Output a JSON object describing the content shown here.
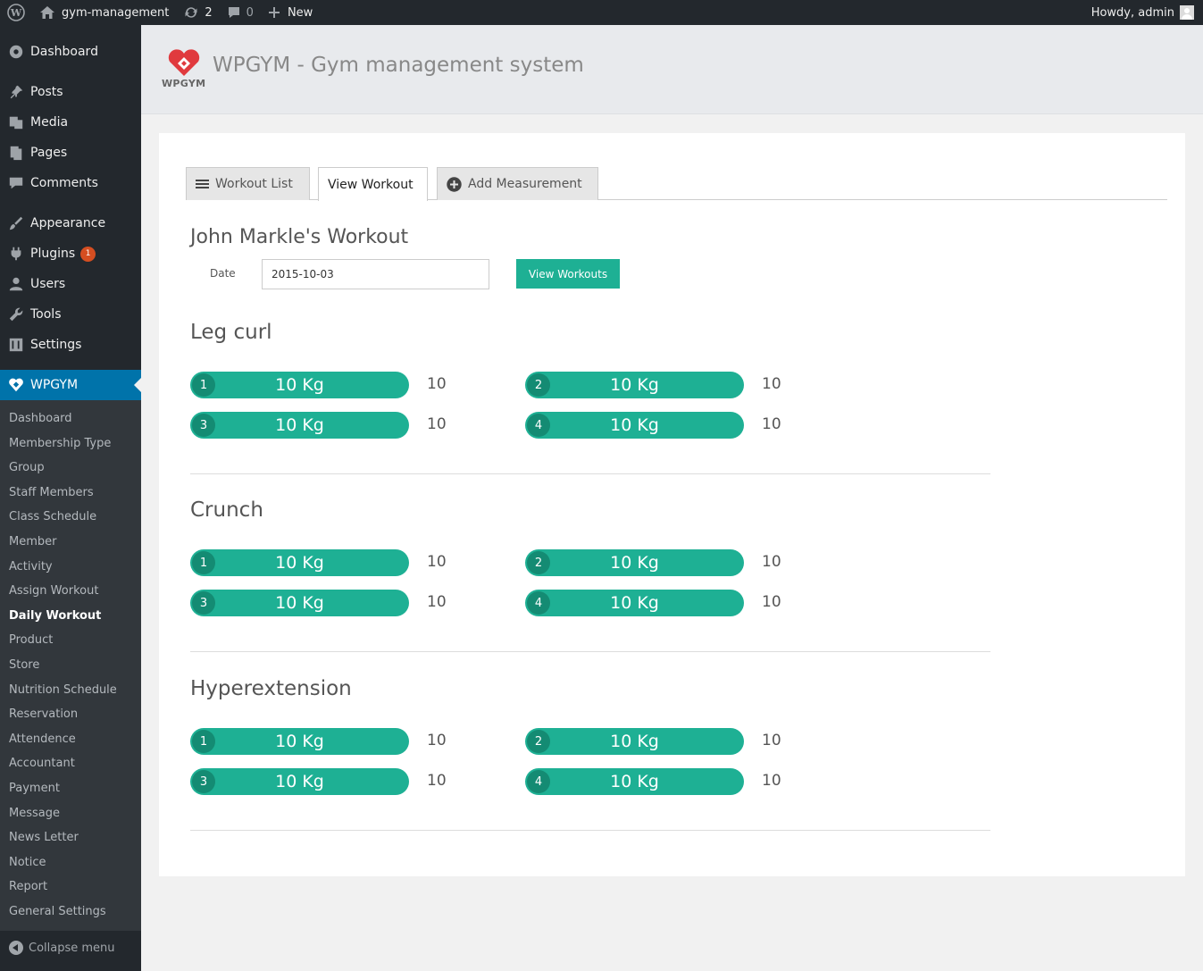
{
  "adminbar": {
    "site_name": "gym-management",
    "updates_count": "2",
    "comments_count": "0",
    "new_label": "New",
    "howdy": "Howdy, admin"
  },
  "sidebar": {
    "top_items": [
      {
        "label": "Dashboard",
        "icon": "dashboard-icon"
      },
      {
        "label": "Posts",
        "icon": "pin-icon"
      },
      {
        "label": "Media",
        "icon": "media-icon"
      },
      {
        "label": "Pages",
        "icon": "pages-icon"
      },
      {
        "label": "Comments",
        "icon": "comment-icon"
      },
      {
        "label": "Appearance",
        "icon": "brush-icon"
      },
      {
        "label": "Plugins",
        "icon": "plug-icon",
        "badge": "1"
      },
      {
        "label": "Users",
        "icon": "user-icon"
      },
      {
        "label": "Tools",
        "icon": "wrench-icon"
      },
      {
        "label": "Settings",
        "icon": "settings-icon"
      }
    ],
    "active_item": {
      "label": "WPGYM",
      "icon": "wpgym-icon"
    },
    "sub_items": [
      "Dashboard",
      "Membership Type",
      "Group",
      "Staff Members",
      "Class Schedule",
      "Member",
      "Activity",
      "Assign Workout",
      "Daily Workout",
      "Product",
      "Store",
      "Nutrition Schedule",
      "Reservation",
      "Attendence",
      "Accountant",
      "Payment",
      "Message",
      "News Letter",
      "Notice",
      "Report",
      "General Settings"
    ],
    "current_sub_item": "Daily Workout",
    "collapse_label": "Collapse menu"
  },
  "header": {
    "logo_text": "WPGYM",
    "title": "WPGYM - Gym management system",
    "brand_color": "#e03a3e"
  },
  "tabs": [
    {
      "label": "Workout List",
      "icon": "list-icon",
      "active": false
    },
    {
      "label": "View Workout",
      "icon": "",
      "active": true
    },
    {
      "label": "Add Measurement",
      "icon": "plus-circle-icon",
      "active": false
    }
  ],
  "workout": {
    "title": "John Markle's Workout",
    "date_label": "Date",
    "date_value": "2015-10-03",
    "button_label": "View Workouts",
    "accent_color": "#1eb094",
    "exercises": [
      {
        "name": "Leg curl",
        "sets": [
          {
            "num": "1",
            "weight": "10 Kg",
            "reps": "10"
          },
          {
            "num": "2",
            "weight": "10 Kg",
            "reps": "10"
          },
          {
            "num": "3",
            "weight": "10 Kg",
            "reps": "10"
          },
          {
            "num": "4",
            "weight": "10 Kg",
            "reps": "10"
          }
        ]
      },
      {
        "name": "Crunch",
        "sets": [
          {
            "num": "1",
            "weight": "10 Kg",
            "reps": "10"
          },
          {
            "num": "2",
            "weight": "10 Kg",
            "reps": "10"
          },
          {
            "num": "3",
            "weight": "10 Kg",
            "reps": "10"
          },
          {
            "num": "4",
            "weight": "10 Kg",
            "reps": "10"
          }
        ]
      },
      {
        "name": "Hyperextension",
        "sets": [
          {
            "num": "1",
            "weight": "10 Kg",
            "reps": "10"
          },
          {
            "num": "2",
            "weight": "10 Kg",
            "reps": "10"
          },
          {
            "num": "3",
            "weight": "10 Kg",
            "reps": "10"
          },
          {
            "num": "4",
            "weight": "10 Kg",
            "reps": "10"
          }
        ]
      }
    ]
  }
}
